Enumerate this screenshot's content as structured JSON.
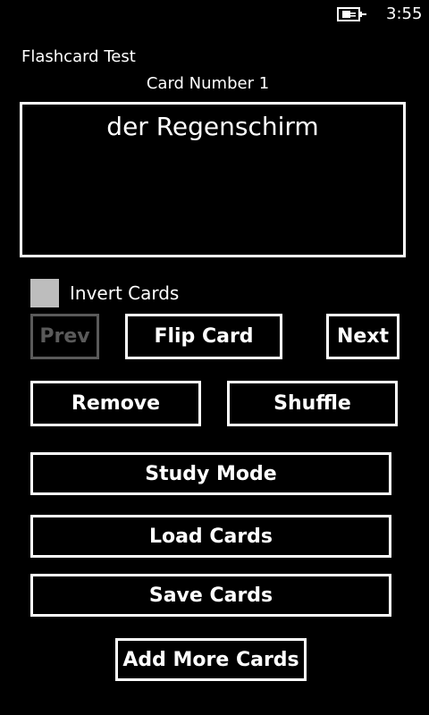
{
  "status_bar": {
    "time": "3:55",
    "battery_icon": "battery-charging-icon"
  },
  "app": {
    "title": "Flashcard Test",
    "card_number_label": "Card Number 1"
  },
  "card": {
    "text": "der Regenschirm"
  },
  "options": {
    "invert_cards_label": "Invert Cards",
    "invert_cards_checked": false
  },
  "buttons": {
    "prev": "Prev",
    "flip": "Flip Card",
    "next": "Next",
    "remove": "Remove",
    "shuffle": "Shuffle",
    "study_mode": "Study Mode",
    "load_cards": "Load Cards",
    "save_cards": "Save Cards",
    "add_more_cards": "Add More Cards"
  },
  "colors": {
    "background": "#000000",
    "foreground": "#ffffff",
    "disabled": "#5a5a5a",
    "checkbox_fill": "#bdbdbd"
  }
}
